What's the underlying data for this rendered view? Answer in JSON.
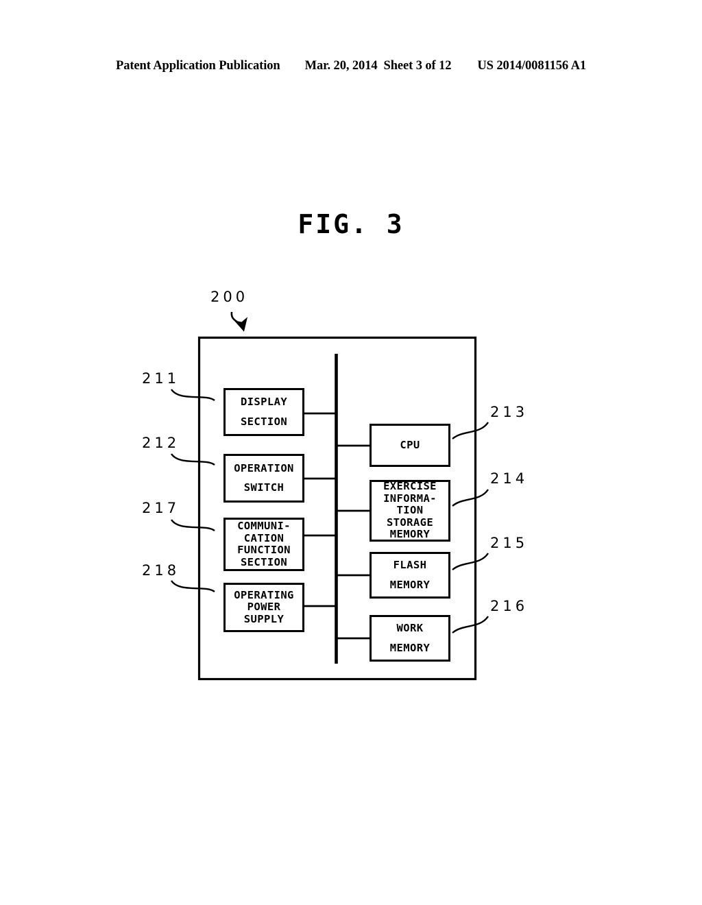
{
  "page": {
    "header": {
      "publication": "Patent Application Publication",
      "date": "Mar. 20, 2014",
      "sheet": "Sheet 3 of 12",
      "patent_number": "US 2014/0081156 A1"
    },
    "figure_title": "FIG. 3",
    "ink_color": "#000000",
    "background_color": "#ffffff"
  },
  "diagram": {
    "assembly_label": "200",
    "left_blocks": [
      {
        "ref": "211",
        "lines": [
          "DISPLAY",
          "SECTION"
        ]
      },
      {
        "ref": "212",
        "lines": [
          "OPERATION",
          "SWITCH"
        ]
      },
      {
        "ref": "217",
        "lines": [
          "COMMUNI-",
          "CATION",
          "FUNCTION",
          "SECTION"
        ]
      },
      {
        "ref": "218",
        "lines": [
          "OPERATING",
          "POWER",
          "SUPPLY"
        ]
      }
    ],
    "right_blocks": [
      {
        "ref": "213",
        "lines": [
          "CPU"
        ]
      },
      {
        "ref": "214",
        "lines": [
          "EXERCISE",
          "INFORMA-",
          "TION",
          "STORAGE",
          "MEMORY"
        ]
      },
      {
        "ref": "215",
        "lines": [
          "FLASH",
          "MEMORY"
        ]
      },
      {
        "ref": "216",
        "lines": [
          "WORK",
          "MEMORY"
        ]
      }
    ]
  }
}
